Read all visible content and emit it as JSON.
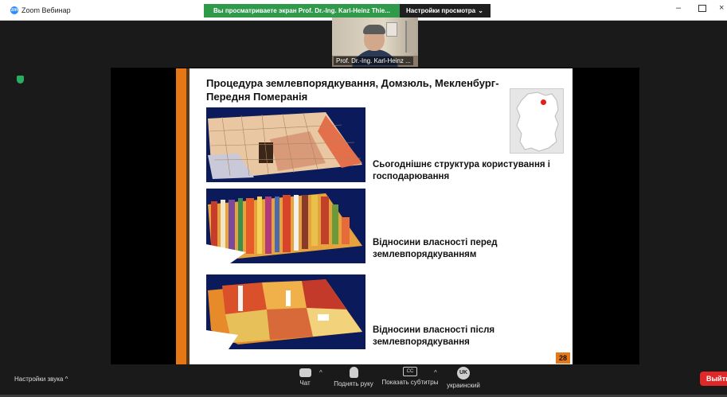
{
  "window": {
    "app_logo": "zm",
    "title": "Zoom Вебинар",
    "minimize": "–",
    "close": "×"
  },
  "share_bar": {
    "banner_text": "Вы просматриваете экран Prof. Dr.-Ing. Karl-Heinz Thie...",
    "view_options_label": "Настройки просмотра",
    "view_options_chevron": "⌄"
  },
  "participant": {
    "name": "Prof. Dr.-Ing. Karl-Heinz ..."
  },
  "slide": {
    "title": "Процедура землевпорядкування, Домзюль, Мекленбург-Передня Померанія",
    "captions": [
      "Сьогоднішнє структура користування і господарювання",
      "Відносини власності перед землевпорядкуванням",
      "Відносини власності після землевпорядкування"
    ],
    "page_number": "28"
  },
  "toolbar": {
    "audio_settings": "Настройки звука",
    "audio_caret": "^",
    "chat": "Чат",
    "chat_caret": "^",
    "raise_hand": "Поднять руку",
    "captions": "Показать субтитры",
    "captions_caret": "^",
    "cc_icon_text": "CC",
    "language": "украинский",
    "language_icon_text": "UK",
    "leave": "Выйти"
  },
  "icons": {
    "shield": "shield-icon",
    "chat": "chat-icon",
    "raise_hand": "hand-icon",
    "captions": "cc-icon",
    "language": "globe-icon"
  },
  "colors": {
    "share_banner": "#2e9a4a",
    "slide_accent": "#e57716",
    "leave": "#e02828",
    "map_marker": "#e0201a"
  }
}
